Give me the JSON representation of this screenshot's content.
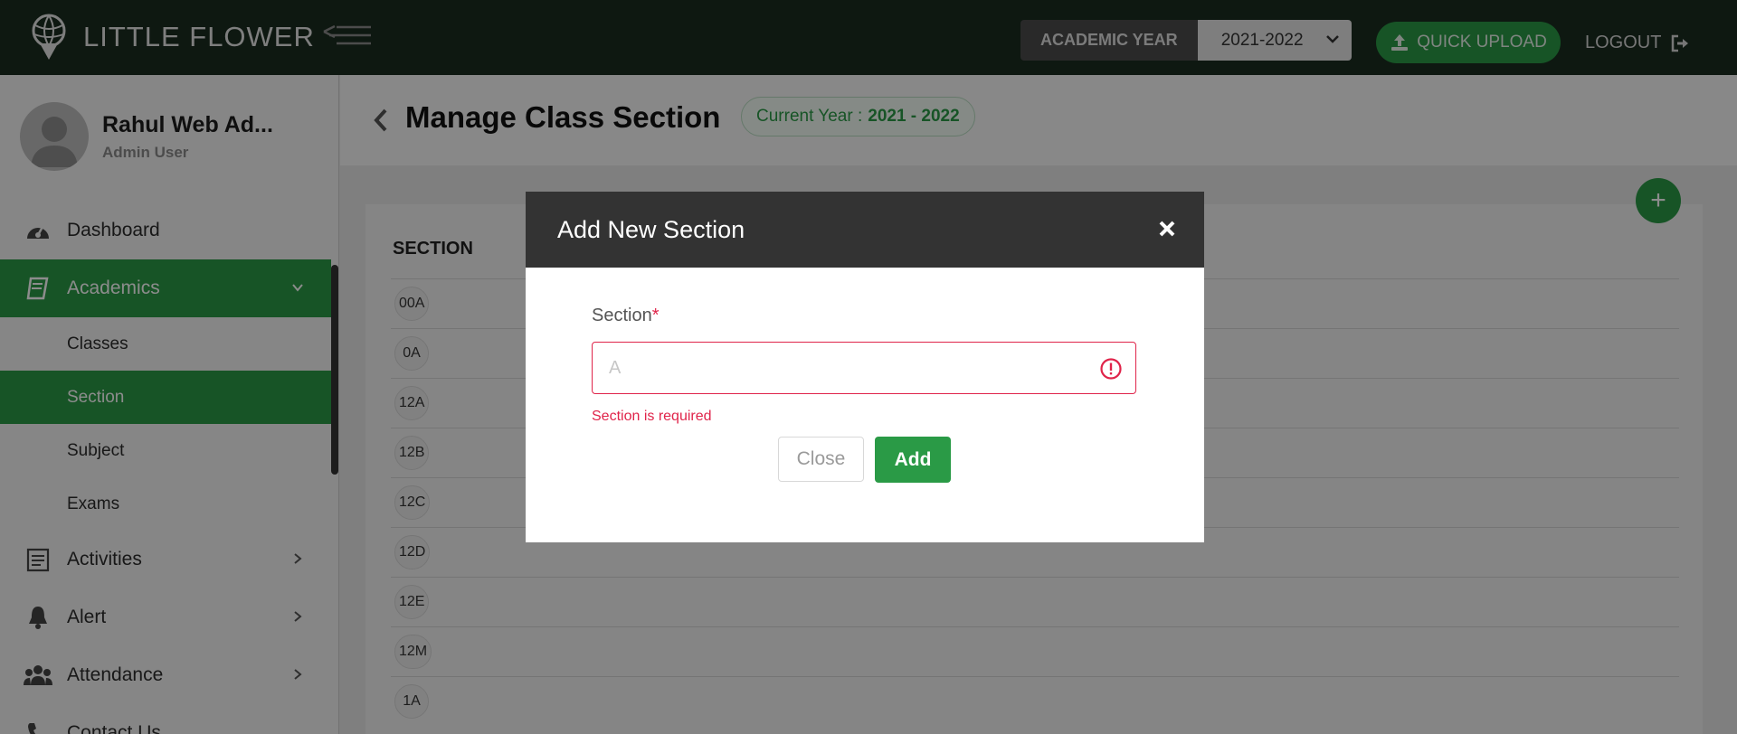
{
  "topbar": {
    "brand": "LITTLE FLOWER",
    "academic_year_label": "ACADEMIC YEAR",
    "academic_year_value": "2021-2022",
    "quick_upload_label": "QUICK UPLOAD",
    "logout_label": "LOGOUT"
  },
  "sidebar": {
    "profile_name": "Rahul Web Ad...",
    "profile_role": "Admin User",
    "items": [
      {
        "label": "Dashboard",
        "icon": "dashboard-icon"
      },
      {
        "label": "Academics",
        "icon": "book-icon",
        "expanded": true
      },
      {
        "label": "Activities",
        "icon": "clipboard-icon"
      },
      {
        "label": "Alert",
        "icon": "bell-icon"
      },
      {
        "label": "Attendance",
        "icon": "users-icon"
      },
      {
        "label": "Contact Us",
        "icon": "phone-icon"
      }
    ],
    "sub_items": [
      "Classes",
      "Section",
      "Subject",
      "Exams"
    ],
    "active_sub_item": "Section"
  },
  "page": {
    "title": "Manage Class Section",
    "current_year_label": "Current Year :",
    "current_year_value": "2021 - 2022",
    "add_button": "+"
  },
  "table": {
    "column": "SECTION",
    "rows": [
      "00A",
      "0A",
      "12A",
      "12B",
      "12C",
      "12D",
      "12E",
      "12M",
      "1A"
    ]
  },
  "modal": {
    "title": "Add New Section",
    "field_label": "Section",
    "required_mark": "*",
    "field_value": "",
    "field_placeholder": "A",
    "error": "Section is required",
    "close_label": "Close",
    "add_label": "Add"
  },
  "colors": {
    "brand_green": "#2a9a46",
    "topbar_bg": "#1a2c1f",
    "error_red": "#e0244a",
    "modal_header": "#333333"
  }
}
